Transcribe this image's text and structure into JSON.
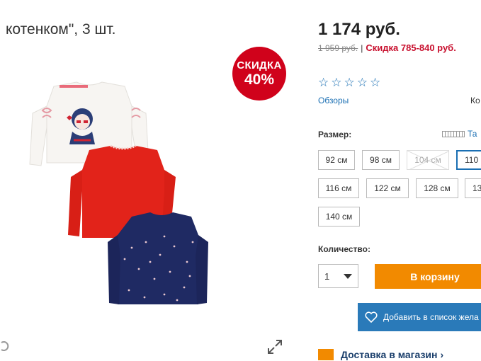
{
  "product": {
    "title": "котенком\", 3 шт.",
    "badge_line1": "СКИДКА",
    "badge_line2": "40%"
  },
  "price": {
    "current": "1 174 руб.",
    "old": "1 959 руб.",
    "separator": "|",
    "discount": "Скидка 785-840 руб."
  },
  "rating": {
    "stars": [
      "☆",
      "☆",
      "☆",
      "☆",
      "☆"
    ],
    "reviews_label": "Обзоры",
    "cut_label": "Ко"
  },
  "size": {
    "label": "Размер:",
    "chart_label": "Та",
    "options": [
      "92 см",
      "98 см",
      "104 см",
      "110 с",
      "116 см",
      "122 см",
      "128 см",
      "13",
      "140 см"
    ]
  },
  "quantity": {
    "label": "Количество:",
    "value": "1"
  },
  "actions": {
    "add_to_cart": "В корзину",
    "wishlist": "Добавить в список жела"
  },
  "delivery": {
    "label": "Доставка в магазин",
    "chevron": "›"
  },
  "colors": {
    "badge": "#d0021b",
    "link": "#1a6fb3",
    "cart": "#f28a00",
    "wishlist": "#2a7ab9",
    "discount": "#c8102e"
  },
  "icons": [
    "zoom-expand-icon",
    "heart-icon",
    "ruler-icon",
    "delivery-icon",
    "star-icon",
    "chevron-down-icon"
  ]
}
